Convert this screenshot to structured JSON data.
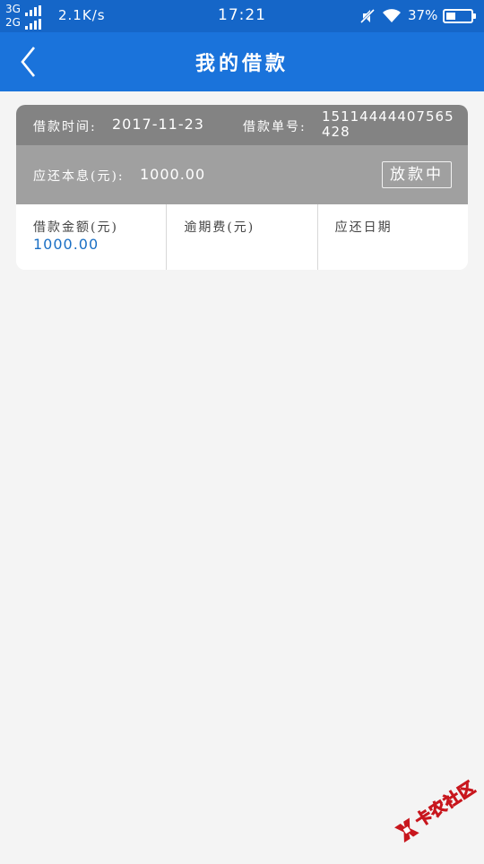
{
  "status_bar": {
    "network_top": "3G",
    "network_bottom": "2G",
    "speed": "2.1K/s",
    "time": "17:21",
    "battery_percent": "37%",
    "battery_level": 0.37,
    "icons": [
      "signal-icon",
      "mute-icon",
      "wifi-icon",
      "battery-icon"
    ]
  },
  "header": {
    "title": "我的借款",
    "back_icon": "chevron-left-icon",
    "background": "#1a73db"
  },
  "loan": {
    "time_label": "借款时间:",
    "time_value": "2017-11-23",
    "number_label": "借款单号:",
    "number_value": "15114444407565428",
    "due_label": "应还本息(元):",
    "due_value": "1000.00",
    "status": "放款中",
    "stats": [
      {
        "label": "借款金额(元)",
        "value": "1000.00"
      },
      {
        "label": "逾期费(元)",
        "value": ""
      },
      {
        "label": "应还日期",
        "value": ""
      }
    ]
  },
  "watermark": {
    "text": "卡农社区",
    "color": "#c8161d"
  }
}
